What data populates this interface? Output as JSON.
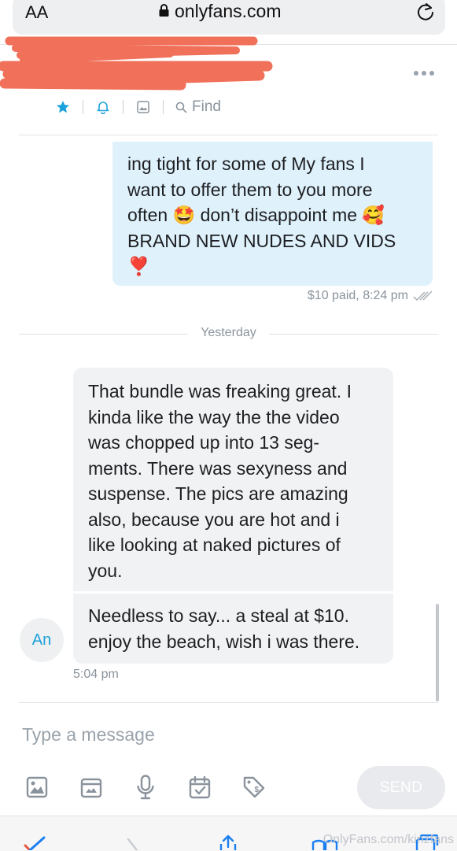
{
  "browser": {
    "text_size_label": "AA",
    "domain": "onlyfans.com",
    "watermark": "OnlyFans.com/kinzfans"
  },
  "toolbar": {
    "find_label": "Find"
  },
  "messages": {
    "outgoing": {
      "lines": [
        "ing tight for some of My fans I",
        "want to offer them to you more",
        "often 🤩 don’t disappoint me 🥰",
        "BRAND NEW NUDES AND VIDS",
        "❣️"
      ],
      "meta": "$10 paid, 8:24 pm"
    },
    "date_separator": "Yesterday",
    "incoming_1": {
      "lines": [
        "That bundle was freaking great. I",
        "kinda like the way the the video",
        "was chopped up into 13 seg-",
        "ments. There was sexyness and",
        "suspense. The pics are amazing",
        "also, because you are hot and i",
        "like looking at naked pictures of",
        "you."
      ]
    },
    "incoming_2": {
      "lines": [
        "Needless to say... a steal at $10.",
        "enjoy the beach, wish i was there."
      ]
    },
    "avatar_initials": "An",
    "incoming_time": "5:04 pm"
  },
  "composer": {
    "placeholder": "Type a message",
    "send_label": "SEND"
  },
  "colors": {
    "accent": "#1ba1dc",
    "outgoing_bubble": "#dff1fb",
    "incoming_bubble": "#f1f2f4",
    "redaction": "#f0705a"
  }
}
